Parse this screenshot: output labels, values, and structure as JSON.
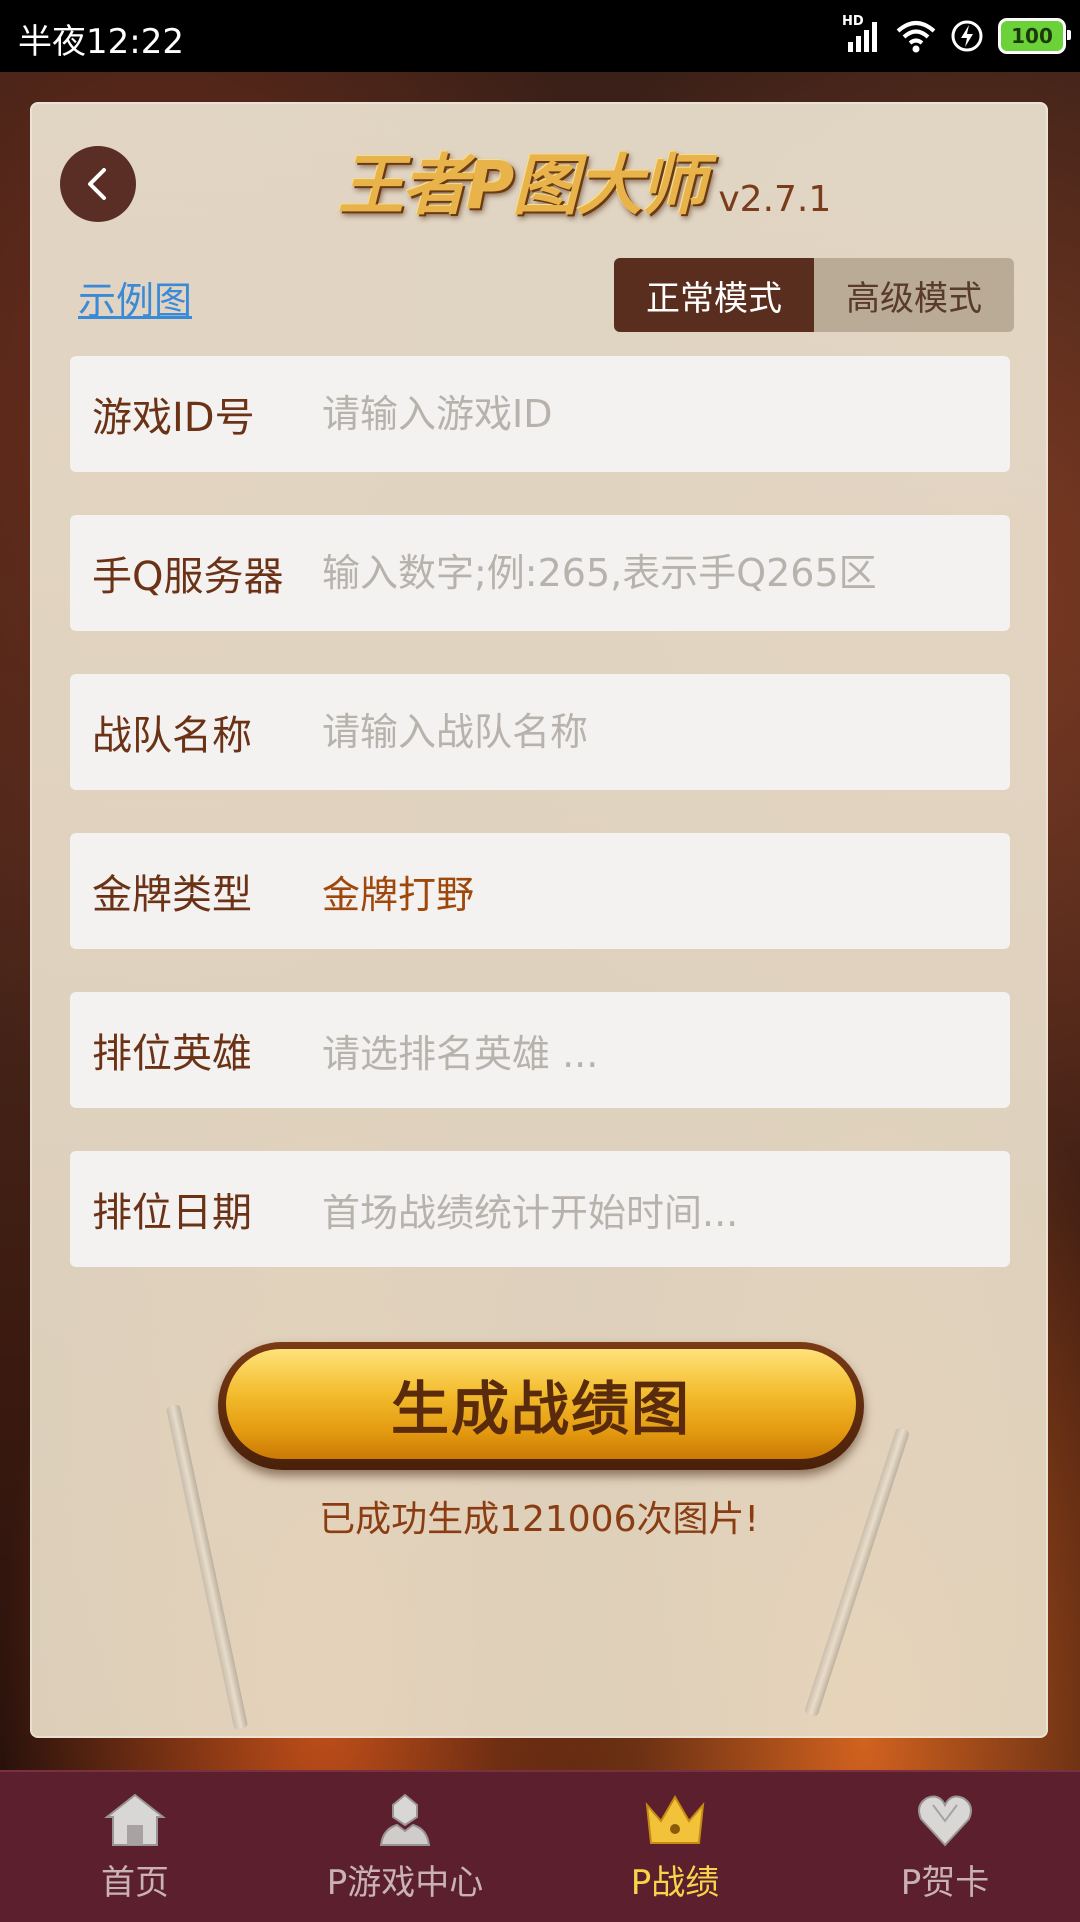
{
  "status_bar": {
    "time": "半夜12:22",
    "network": "HD",
    "battery": "100"
  },
  "header": {
    "app_title": "王者P图大师",
    "version": "v2.7.1",
    "back_icon": "chevron-left-icon"
  },
  "example_link": "示例图",
  "mode_toggle": {
    "normal": "正常模式",
    "advanced": "高级模式",
    "selected": "正常模式"
  },
  "form": {
    "game_id": {
      "label": "游戏ID号",
      "placeholder": "请输入游戏ID",
      "value": ""
    },
    "server": {
      "label": "手Q服务器",
      "placeholder": "输入数字;例:265,表示手Q265区",
      "value": ""
    },
    "team_name": {
      "label": "战队名称",
      "placeholder": "请输入战队名称",
      "value": ""
    },
    "medal_type": {
      "label": "金牌类型",
      "value": "金牌打野"
    },
    "ranked_hero": {
      "label": "排位英雄",
      "placeholder": "请选排名英雄 ..."
    },
    "ranked_date": {
      "label": "排位日期",
      "placeholder": "首场战绩统计开始时间..."
    }
  },
  "generate": {
    "button_label": "生成战绩图",
    "count_text": "已成功生成121006次图片!"
  },
  "bottom_nav": {
    "items": [
      {
        "label": "首页",
        "icon": "home-icon"
      },
      {
        "label": "P游戏中心",
        "icon": "user-icon"
      },
      {
        "label": "P战绩",
        "icon": "crown-icon"
      },
      {
        "label": "P贺卡",
        "icon": "heart-icon"
      }
    ],
    "active": "P战绩"
  },
  "colors": {
    "accent_dark": "#5a2e1e",
    "label_brown": "#6b3216",
    "nav_background": "#5b1f2d",
    "nav_active": "#f5d54a",
    "link_blue": "#3a8ad8"
  }
}
